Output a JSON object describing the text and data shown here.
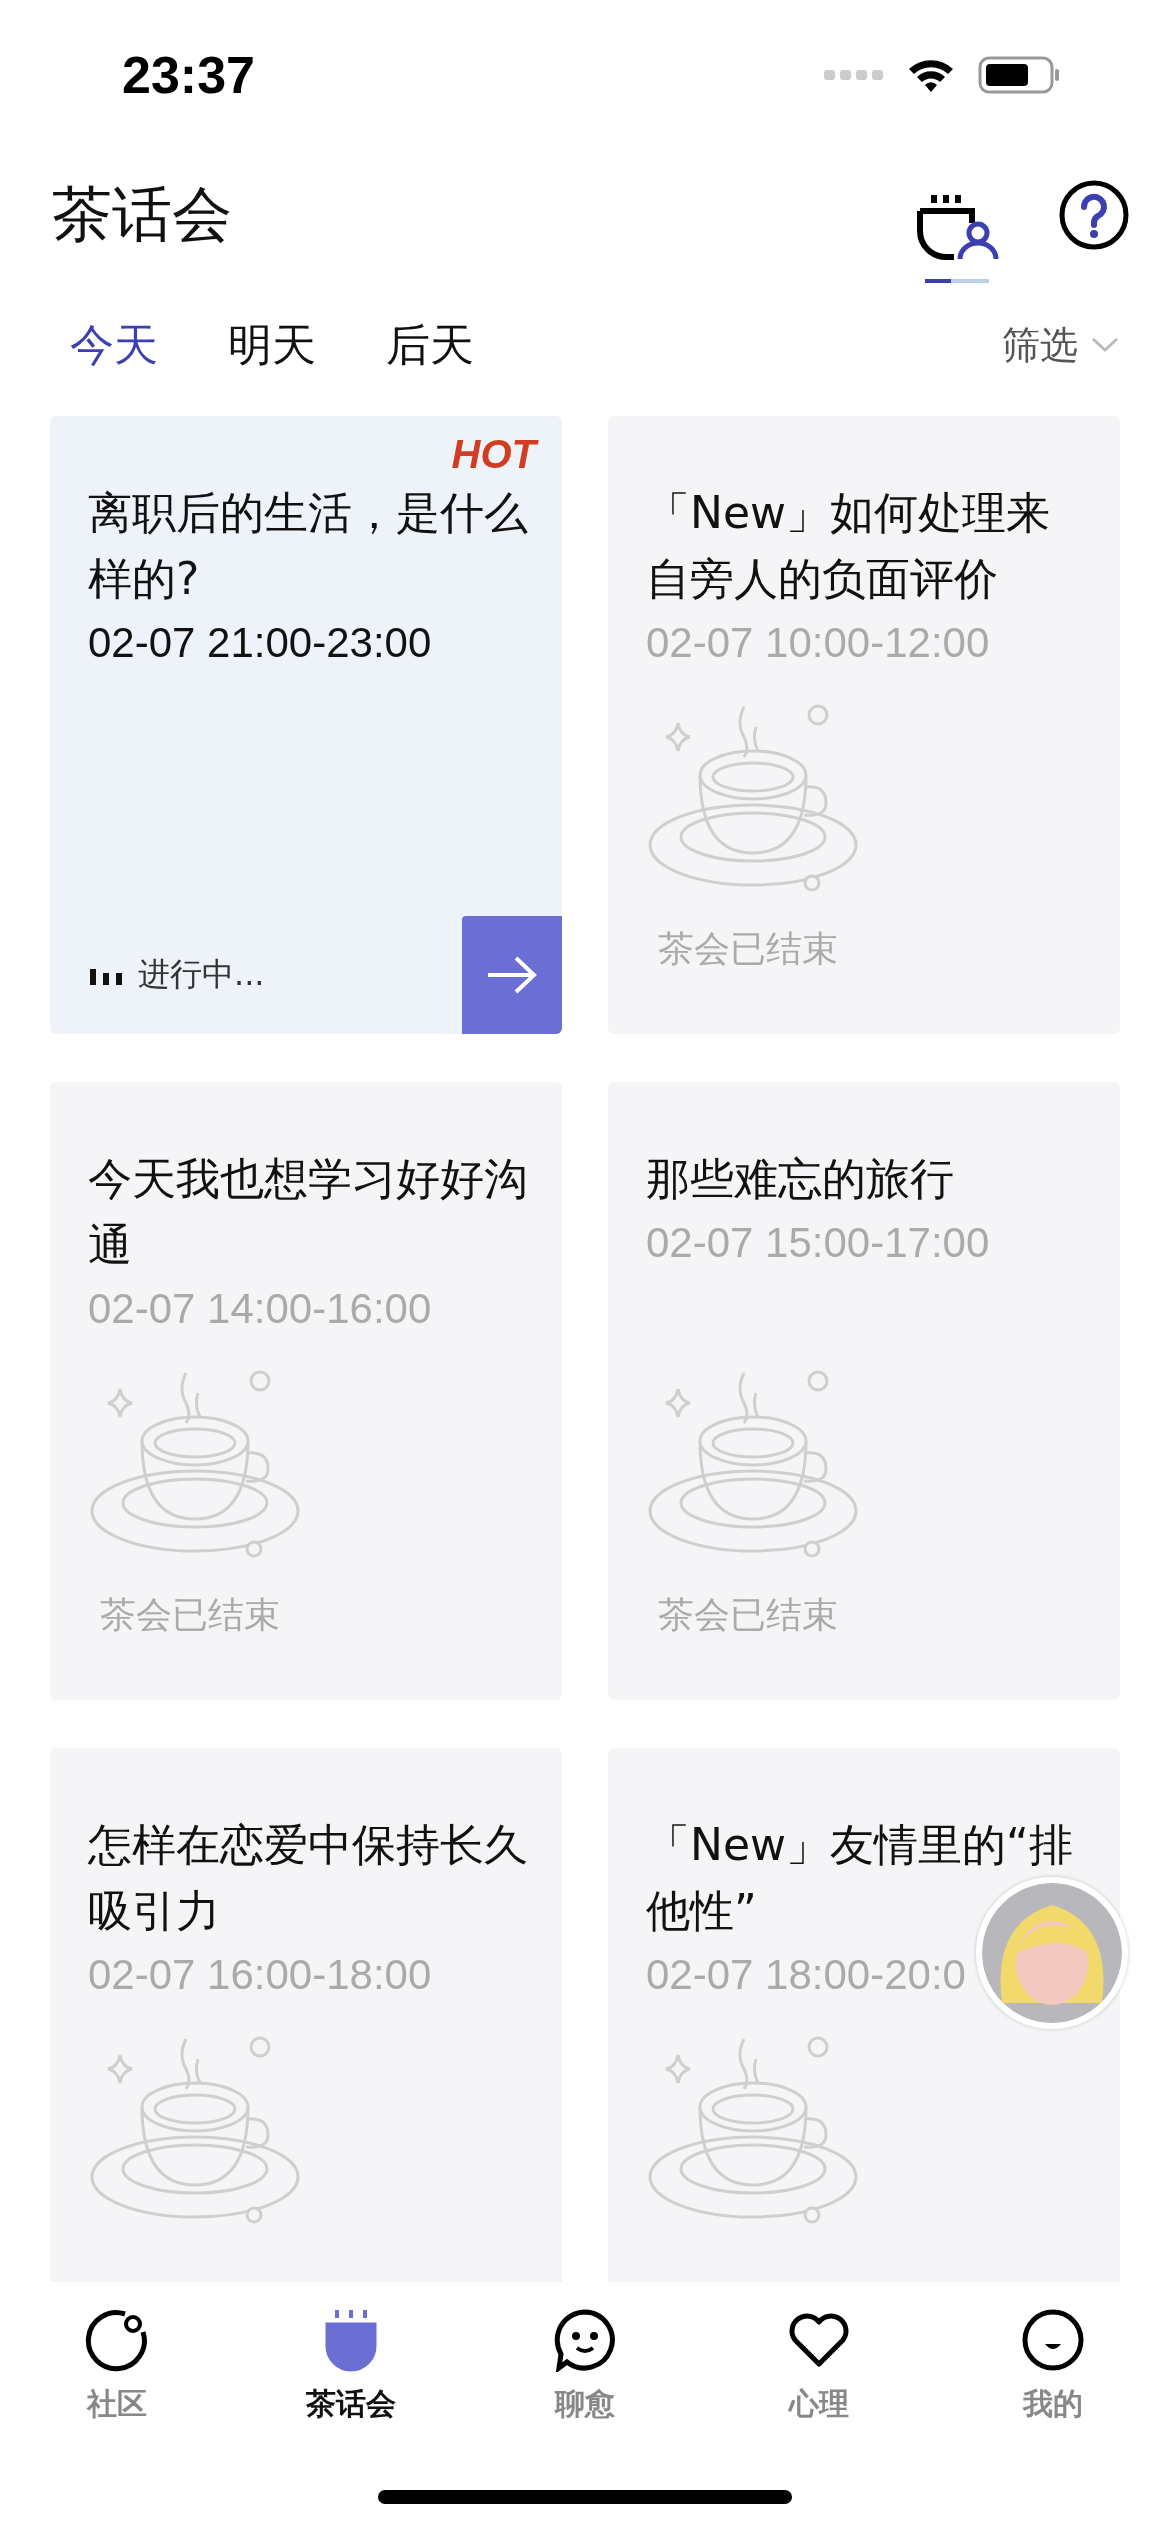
{
  "status_bar": {
    "time": "23:37"
  },
  "header": {
    "title": "茶话会"
  },
  "day_tabs": [
    {
      "label": "今天",
      "selected": true
    },
    {
      "label": "明天",
      "selected": false
    },
    {
      "label": "后天",
      "selected": false
    }
  ],
  "filter": {
    "label": "筛选"
  },
  "cards": [
    {
      "kind": "live",
      "badge": "HOT",
      "title": "离职后的生活，是什么样的?",
      "time": "02-07 21:00-23:00",
      "status": "进行中..."
    },
    {
      "kind": "ended",
      "title": "「New」如何处理来自旁人的负面评价",
      "time": "02-07 10:00-12:00",
      "status": "茶会已结束"
    },
    {
      "kind": "ended",
      "title": "今天我也想学习好好沟通",
      "time": "02-07 14:00-16:00",
      "status": "茶会已结束"
    },
    {
      "kind": "ended",
      "title": "那些难忘的旅行",
      "time": "02-07 15:00-17:00",
      "status": "茶会已结束"
    },
    {
      "kind": "ended",
      "title": "怎样在恋爱中保持长久吸引力",
      "time": "02-07 16:00-18:00"
    },
    {
      "kind": "ended",
      "title": "「New」友情里的“排他性”",
      "time": "02-07 18:00-20:0"
    }
  ],
  "tab_bar": [
    {
      "label": "社区",
      "selected": false
    },
    {
      "label": "茶话会",
      "selected": true
    },
    {
      "label": "聊愈",
      "selected": false
    },
    {
      "label": "心理",
      "selected": false
    },
    {
      "label": "我的",
      "selected": false
    }
  ]
}
